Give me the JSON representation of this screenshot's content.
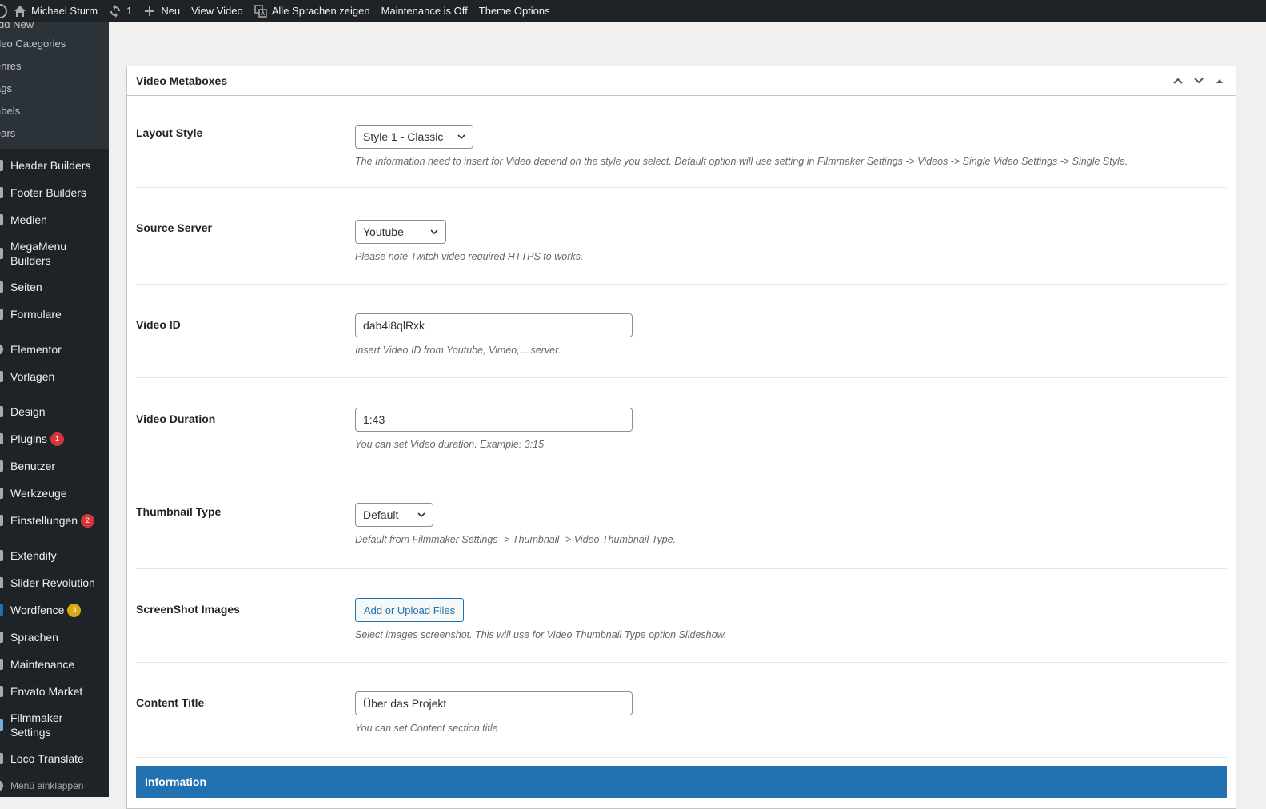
{
  "adminbar": {
    "site_name": "Michael Sturm",
    "updates_count": "1",
    "new_label": "Neu",
    "view_label": "View Video",
    "languages_label": "Alle Sprachen zeigen",
    "maintenance_label": "Maintenance is Off",
    "theme_options_label": "Theme Options"
  },
  "submenu": {
    "items": [
      "dd New",
      "deo Categories",
      "enres",
      "ags",
      "abels",
      "ears"
    ]
  },
  "sidebar": {
    "items": [
      {
        "label": "Header Builders",
        "icon": "header-builder-icon"
      },
      {
        "label": "Footer Builders",
        "icon": "footer-builder-icon"
      },
      {
        "label": "Medien",
        "icon": "media-icon"
      },
      {
        "label": "MegaMenu Builders",
        "icon": "megamenu-icon"
      },
      {
        "label": "Seiten",
        "icon": "pages-icon"
      },
      {
        "label": "Formulare",
        "icon": "forms-icon"
      },
      {
        "label": "Elementor",
        "icon": "elementor-icon"
      },
      {
        "label": "Vorlagen",
        "icon": "templates-icon"
      },
      {
        "label": "Design",
        "icon": "appearance-icon"
      },
      {
        "label": "Plugins",
        "icon": "plugins-icon",
        "badge": "1"
      },
      {
        "label": "Benutzer",
        "icon": "users-icon"
      },
      {
        "label": "Werkzeuge",
        "icon": "tools-icon"
      },
      {
        "label": "Einstellungen",
        "icon": "settings-icon",
        "badge": "2"
      },
      {
        "label": "Extendify",
        "icon": "extendify-icon"
      },
      {
        "label": "Slider Revolution",
        "icon": "slider-icon"
      },
      {
        "label": "Wordfence",
        "icon": "wordfence-icon",
        "badge": "3"
      },
      {
        "label": "Sprachen",
        "icon": "languages-icon"
      },
      {
        "label": "Maintenance",
        "icon": "maintenance-icon"
      },
      {
        "label": "Envato Market",
        "icon": "envato-icon"
      },
      {
        "label": "Filmmaker Settings",
        "icon": "filmmaker-icon"
      },
      {
        "label": "Loco Translate",
        "icon": "loco-icon"
      },
      {
        "label": "Menü einklappen",
        "icon": "collapse-icon"
      }
    ]
  },
  "metabox": {
    "title": "Video Metaboxes",
    "fields": {
      "layout_style": {
        "label": "Layout Style",
        "value": "Style 1 - Classic",
        "desc": "The Information need to insert for Video depend on the style you select. Default option will use setting in Filmmaker Settings -> Videos -> Single Video Settings -> Single Style."
      },
      "source_server": {
        "label": "Source Server",
        "value": "Youtube",
        "desc": "Please note Twitch video required HTTPS to works."
      },
      "video_id": {
        "label": "Video ID",
        "value": "dab4i8qlRxk",
        "desc": "Insert Video ID from Youtube, Vimeo,... server."
      },
      "video_duration": {
        "label": "Video Duration",
        "value": "1:43",
        "desc": "You can set Video duration. Example: 3:15"
      },
      "thumbnail_type": {
        "label": "Thumbnail Type",
        "value": "Default",
        "desc": "Default from Filmmaker Settings -> Thumbnail -> Video Thumbnail Type."
      },
      "screenshot_images": {
        "label": "ScreenShot Images",
        "button": "Add or Upload Files",
        "desc": "Select images screenshot. This will use for Video Thumbnail Type option Slideshow."
      },
      "content_title": {
        "label": "Content Title",
        "value": "Über das Projekt",
        "desc": "You can set Content section title"
      }
    },
    "section_header": "Information"
  },
  "colors": {
    "adminbar_bg": "#1d2327",
    "accent": "#2271b1",
    "badge_red": "#d63638",
    "badge_amber": "#dba617"
  }
}
